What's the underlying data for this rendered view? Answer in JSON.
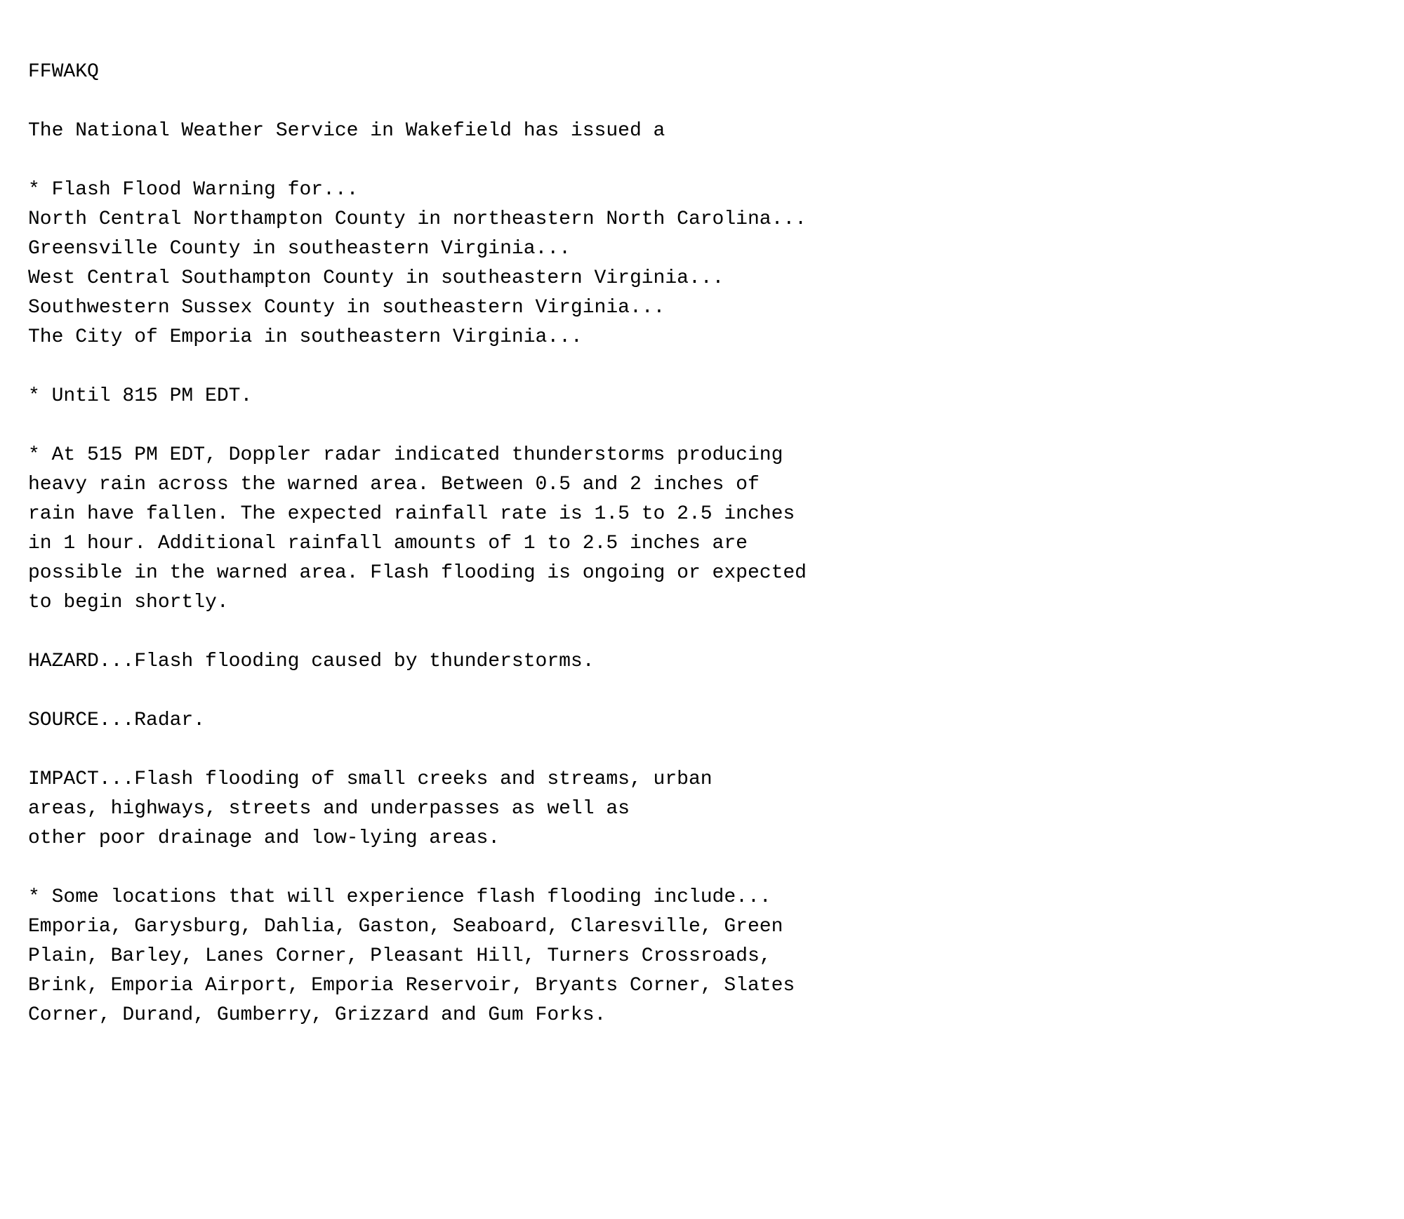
{
  "document": {
    "lines": [
      {
        "id": "header",
        "text": "FFWAKQ",
        "empty": false
      },
      {
        "id": "blank1",
        "text": "",
        "empty": true
      },
      {
        "id": "intro",
        "text": "The National Weather Service in Wakefield has issued a",
        "empty": false
      },
      {
        "id": "blank2",
        "text": "",
        "empty": true
      },
      {
        "id": "warning-header",
        "text": "* Flash Flood Warning for...",
        "empty": false
      },
      {
        "id": "location1",
        "text": "North Central Northampton County in northeastern North Carolina...",
        "empty": false
      },
      {
        "id": "location2",
        "text": "Greensville County in southeastern Virginia...",
        "empty": false
      },
      {
        "id": "location3",
        "text": "West Central Southampton County in southeastern Virginia...",
        "empty": false
      },
      {
        "id": "location4",
        "text": "Southwestern Sussex County in southeastern Virginia...",
        "empty": false
      },
      {
        "id": "location5",
        "text": "The City of Emporia in southeastern Virginia...",
        "empty": false
      },
      {
        "id": "blank3",
        "text": "",
        "empty": true
      },
      {
        "id": "until",
        "text": "* Until 815 PM EDT.",
        "empty": false
      },
      {
        "id": "blank4",
        "text": "",
        "empty": true
      },
      {
        "id": "at-line",
        "text": "* At 515 PM EDT, Doppler radar indicated thunderstorms producing\nheavy rain across the warned area. Between 0.5 and 2 inches of\nrain have fallen. The expected rainfall rate is 1.5 to 2.5 inches\nin 1 hour. Additional rainfall amounts of 1 to 2.5 inches are\npossible in the warned area. Flash flooding is ongoing or expected\nto begin shortly.",
        "empty": false
      },
      {
        "id": "blank5",
        "text": "",
        "empty": true
      },
      {
        "id": "hazard",
        "text": "HAZARD...Flash flooding caused by thunderstorms.",
        "empty": false
      },
      {
        "id": "blank6",
        "text": "",
        "empty": true
      },
      {
        "id": "source",
        "text": "SOURCE...Radar.",
        "empty": false
      },
      {
        "id": "blank7",
        "text": "",
        "empty": true
      },
      {
        "id": "impact",
        "text": "IMPACT...Flash flooding of small creeks and streams, urban\nareas, highways, streets and underpasses as well as\nother poor drainage and low-lying areas.",
        "empty": false
      },
      {
        "id": "blank8",
        "text": "",
        "empty": true
      },
      {
        "id": "locations-header",
        "text": "* Some locations that will experience flash flooding include...",
        "empty": false
      },
      {
        "id": "locations-list",
        "text": "Emporia, Garysburg, Dahlia, Gaston, Seaboard, Claresville, Green\nPlain, Barley, Lanes Corner, Pleasant Hill, Turners Crossroads,\nBrink, Emporia Airport, Emporia Reservoir, Bryants Corner, Slates\nCorner, Durand, Gumberry, Grizzard and Gum Forks.",
        "empty": false
      }
    ]
  }
}
